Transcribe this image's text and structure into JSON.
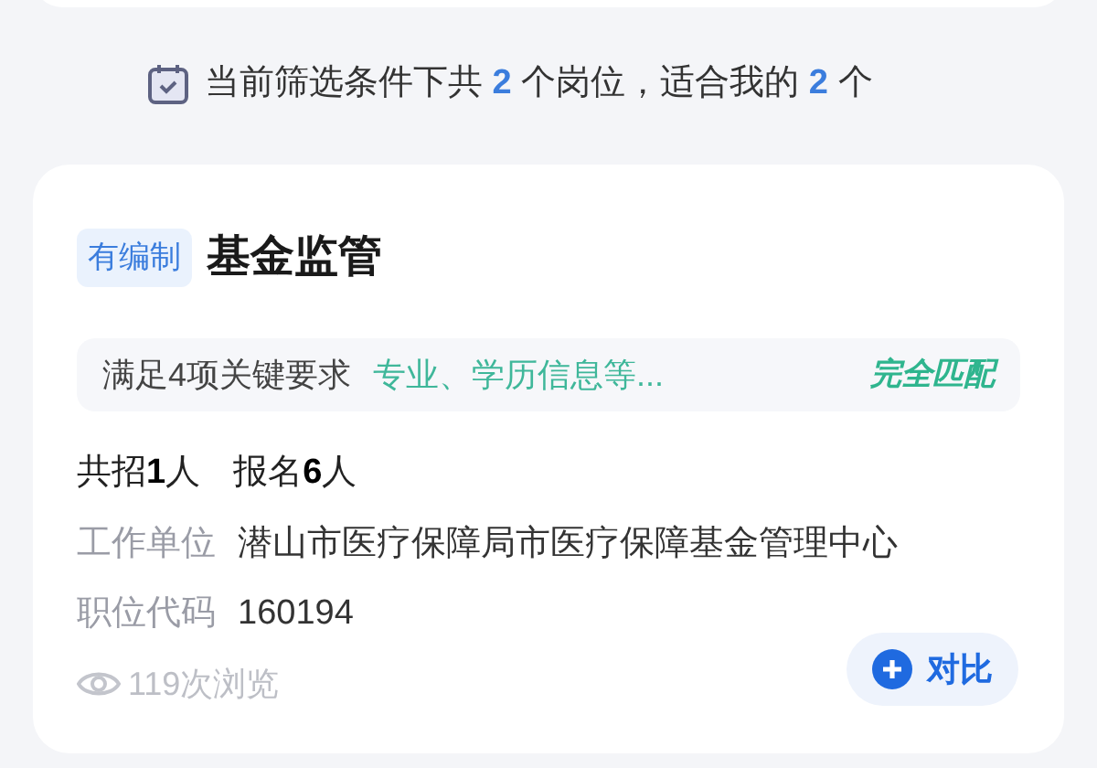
{
  "summary": "当前筛选条件下共 **2** 个岗位，适合我的 **2** 个",
  "job": {
    "tag": "有编制",
    "title": "基金监管",
    "match": {
      "label": "满足4项关键要求",
      "detail": "专业、学历信息等...",
      "result": "完全匹配"
    },
    "stats": [
      "共招**1**人",
      "报名**6**人"
    ],
    "fields": [
      {
        "label": "工作单位",
        "value": "潜山市医疗保障局市医疗保障基金管理中心"
      },
      {
        "label": "职位代码",
        "value": "160194"
      }
    ],
    "views": "119次浏览",
    "compare_button": "对比"
  }
}
